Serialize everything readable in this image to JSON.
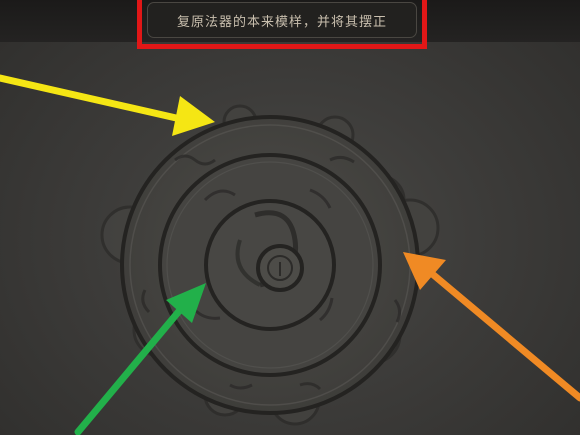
{
  "hint": {
    "text": "复原法器的本来模样，并将其摆正"
  },
  "colors": {
    "frame_highlight": "#e11717",
    "arrow_yellow": "#f5e614",
    "arrow_green": "#22b04a",
    "arrow_orange": "#f08a24",
    "stone": "#4a4945"
  },
  "puzzle": {
    "rings": [
      "outer-ring",
      "middle-ring",
      "inner-ring",
      "center-knob"
    ]
  }
}
